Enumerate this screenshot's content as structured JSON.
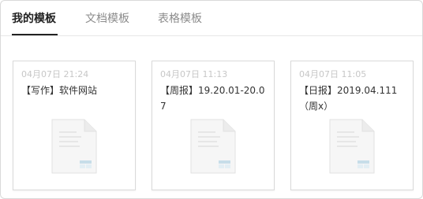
{
  "tabs": [
    {
      "label": "我的模板",
      "active": true
    },
    {
      "label": "文档模板",
      "active": false
    },
    {
      "label": "表格模板",
      "active": false
    }
  ],
  "cards": [
    {
      "time": "04月07日 21:24",
      "title": "【写作】软件网站"
    },
    {
      "time": "04月07日 11:13",
      "title": "【周报】19.20.01-20.07"
    },
    {
      "time": "04月07日 11:05",
      "title": "【日报】2019.04.111（周x）"
    }
  ],
  "icons": {
    "card_thumbnail": "document-template-icon"
  },
  "colors": {
    "active_tab": "#222222",
    "inactive_tab": "#8c8c8c",
    "thumbnail_accent": "#c7dde9"
  }
}
